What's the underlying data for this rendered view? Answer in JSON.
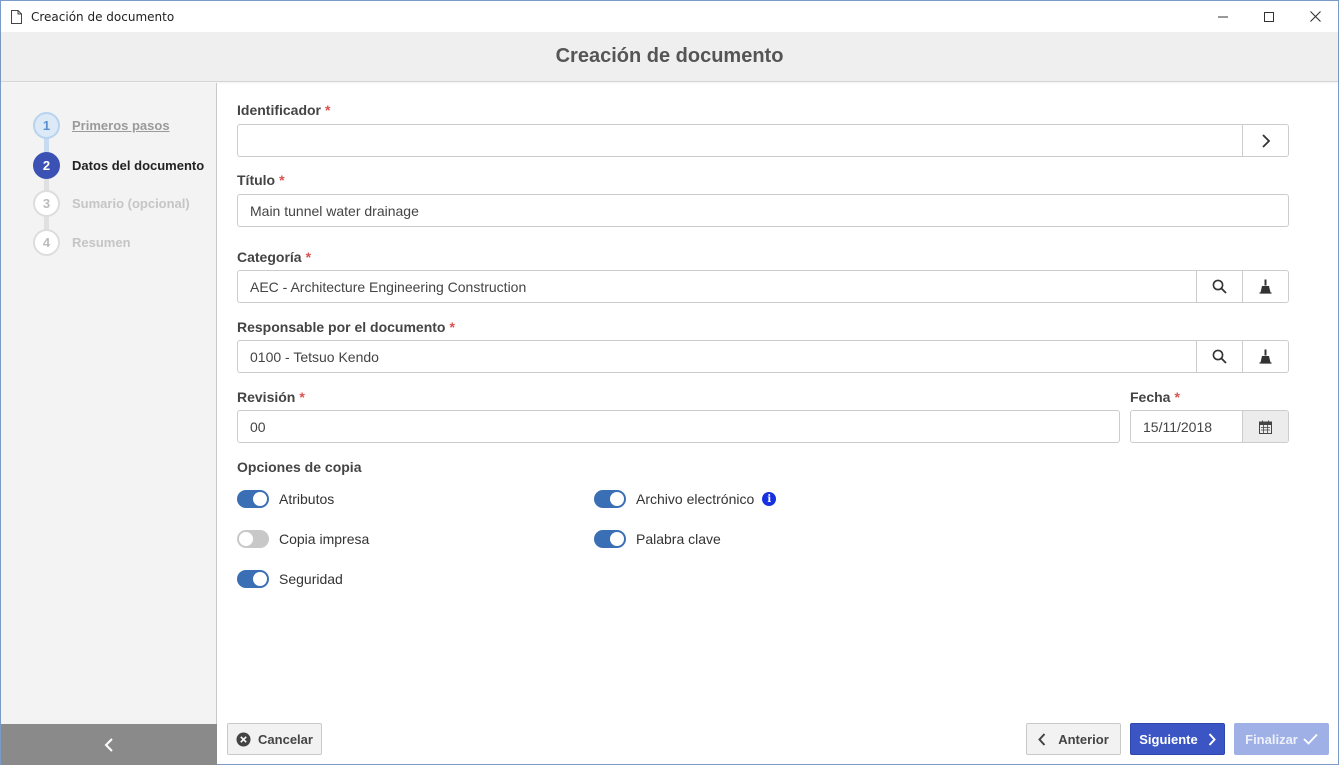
{
  "window": {
    "title": "Creación de documento"
  },
  "header": {
    "title": "Creación de documento"
  },
  "steps": [
    {
      "num": "1",
      "label": "Primeros pasos",
      "state": "done"
    },
    {
      "num": "2",
      "label": "Datos del documento",
      "state": "active"
    },
    {
      "num": "3",
      "label": "Sumario (opcional)",
      "state": "pending"
    },
    {
      "num": "4",
      "label": "Resumen",
      "state": "pending"
    }
  ],
  "form": {
    "identificador": {
      "label": "Identificador",
      "value": ""
    },
    "titulo": {
      "label": "Título",
      "value": "Main tunnel water drainage"
    },
    "categoria": {
      "label": "Categoría",
      "value": "AEC - Architecture Engineering Construction"
    },
    "responsable": {
      "label": "Responsable por el documento",
      "value": "0100 - Tetsuo Kendo"
    },
    "revision": {
      "label": "Revisión",
      "value": "00"
    },
    "fecha": {
      "label": "Fecha",
      "value": "15/11/2018"
    },
    "required_mark": "*"
  },
  "copy_options": {
    "title": "Opciones de copia",
    "atributos": {
      "label": "Atributos",
      "on": true
    },
    "archivo": {
      "label": "Archivo electrónico",
      "on": true
    },
    "copia": {
      "label": "Copia impresa",
      "on": false
    },
    "palabra": {
      "label": "Palabra clave",
      "on": true
    },
    "seguridad": {
      "label": "Seguridad",
      "on": true
    }
  },
  "footer": {
    "cancel": "Cancelar",
    "previous": "Anterior",
    "next": "Siguiente",
    "finish": "Finalizar"
  },
  "colors": {
    "primary": "#3b55c4",
    "toggle_on": "#3a6fb6",
    "required": "#d9534f",
    "info": "#1730e0"
  }
}
